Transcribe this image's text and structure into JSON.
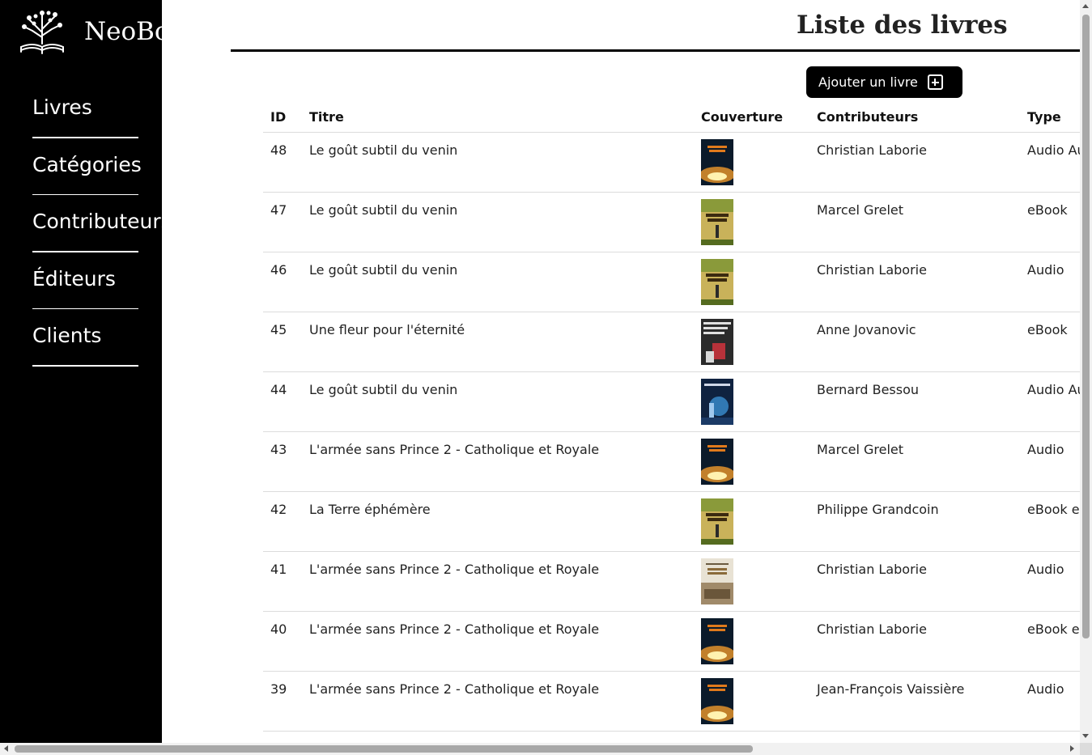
{
  "app": {
    "brand": "NeoBo"
  },
  "sidebar": {
    "items": [
      {
        "label": "Livres"
      },
      {
        "label": "Catégories"
      },
      {
        "label": "Contributeurs"
      },
      {
        "label": "Éditeurs"
      },
      {
        "label": "Clients"
      }
    ]
  },
  "main": {
    "title": "Liste des livres",
    "add_button_label": "Ajouter un livre",
    "table": {
      "headers": {
        "id": "ID",
        "title": "Titre",
        "cover": "Couverture",
        "contributors": "Contributeurs",
        "type": "Type"
      },
      "rows": [
        {
          "id": "48",
          "title": "Le goût subtil du venin",
          "contributor": "Christian Laborie",
          "type": "Audio Au",
          "cover": "terre"
        },
        {
          "id": "47",
          "title": "Le goût subtil du venin",
          "contributor": "Marcel Grelet",
          "type": "eBook",
          "cover": "fumee"
        },
        {
          "id": "46",
          "title": "Le goût subtil du venin",
          "contributor": "Christian Laborie",
          "type": "Audio",
          "cover": "fumee"
        },
        {
          "id": "45",
          "title": "Une fleur pour l'éternité",
          "contributor": "Anne Jovanovic",
          "type": "eBook",
          "cover": "fleur"
        },
        {
          "id": "44",
          "title": "Le goût subtil du venin",
          "contributor": "Bernard Bessou",
          "type": "Audio Au",
          "cover": "blue"
        },
        {
          "id": "43",
          "title": "L'armée sans Prince 2 - Catholique et Royale",
          "contributor": "Marcel Grelet",
          "type": "Audio",
          "cover": "terre"
        },
        {
          "id": "42",
          "title": "La Terre éphémère",
          "contributor": "Philippe Grandcoin",
          "type": "eBook e",
          "cover": "fumee"
        },
        {
          "id": "41",
          "title": "L'armée sans Prince 2 - Catholique et Royale",
          "contributor": "Christian Laborie",
          "type": "Audio",
          "cover": "armee"
        },
        {
          "id": "40",
          "title": "L'armée sans Prince 2 - Catholique et Royale",
          "contributor": "Christian Laborie",
          "type": "eBook e",
          "cover": "terre"
        },
        {
          "id": "39",
          "title": "L'armée sans Prince 2 - Catholique et Royale",
          "contributor": "Jean-François Vaissière",
          "type": "Audio",
          "cover": "terre"
        }
      ]
    }
  },
  "colors": {
    "sidebar_bg": "#000000",
    "accent": "#000000",
    "row_border": "#dcdcdc"
  }
}
